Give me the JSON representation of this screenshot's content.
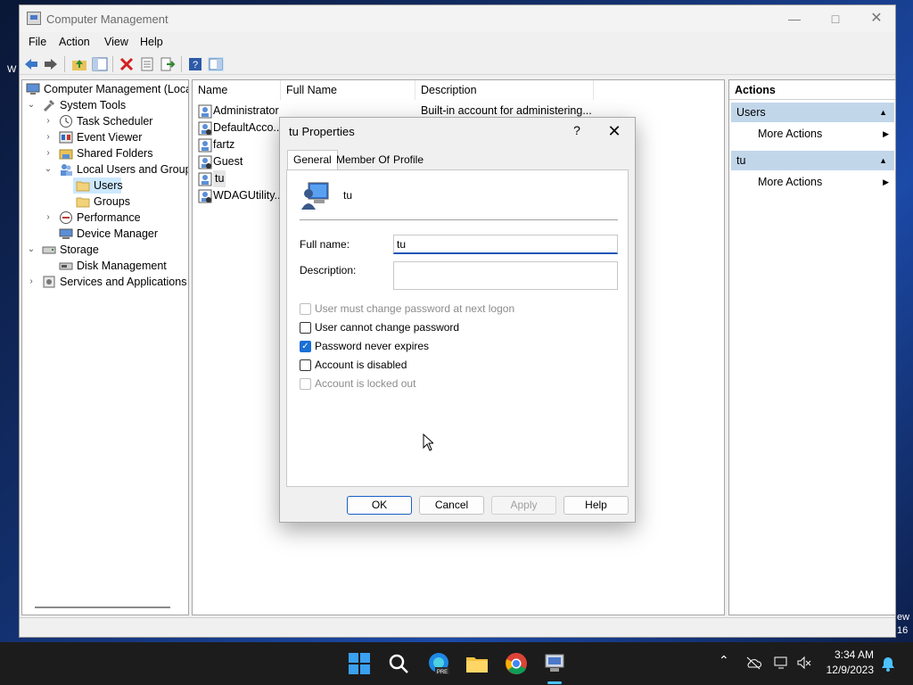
{
  "window": {
    "title": "Computer Management"
  },
  "menu": [
    "File",
    "Action",
    "View",
    "Help"
  ],
  "tree": {
    "items": [
      {
        "label": "Computer Management (Local",
        "icon": "computer-management-icon"
      },
      {
        "label": "System Tools",
        "icon": "system-tools-icon"
      },
      {
        "label": "Task Scheduler",
        "icon": "clock-icon"
      },
      {
        "label": "Event Viewer",
        "icon": "event-viewer-icon"
      },
      {
        "label": "Shared Folders",
        "icon": "shared-folders-icon"
      },
      {
        "label": "Local Users and Groups",
        "icon": "users-groups-icon"
      },
      {
        "label": "Users",
        "icon": "folder-icon"
      },
      {
        "label": "Groups",
        "icon": "folder-icon"
      },
      {
        "label": "Performance",
        "icon": "performance-icon"
      },
      {
        "label": "Device Manager",
        "icon": "device-manager-icon"
      },
      {
        "label": "Storage",
        "icon": "storage-icon"
      },
      {
        "label": "Disk Management",
        "icon": "disk-icon"
      },
      {
        "label": "Services and Applications",
        "icon": "services-icon"
      }
    ]
  },
  "list": {
    "columns": [
      "Name",
      "Full Name",
      "Description"
    ],
    "rows": [
      {
        "name": "Administrator",
        "full_name": "",
        "description": "Built-in account for administering..."
      },
      {
        "name": "DefaultAcco...",
        "full_name": "",
        "description": ""
      },
      {
        "name": "fartz",
        "full_name": "",
        "description": ""
      },
      {
        "name": "Guest",
        "full_name": "",
        "description": ""
      },
      {
        "name": "tu",
        "full_name": "",
        "description": ""
      },
      {
        "name": "WDAGUtility...",
        "full_name": "",
        "description": ""
      }
    ]
  },
  "actions": {
    "header": "Actions",
    "sections": [
      {
        "title": "Users",
        "item": "More Actions"
      },
      {
        "title": "tu",
        "item": "More Actions"
      }
    ]
  },
  "dialog": {
    "title": "tu Properties",
    "help_glyph": "?",
    "tabs": [
      "General",
      "Member Of",
      "Profile"
    ],
    "username": "tu",
    "full_name_label": "Full name:",
    "full_name_value": "tu",
    "description_label": "Description:",
    "description_value": "",
    "checkboxes": [
      {
        "label": "User must change password at next logon",
        "checked": false,
        "enabled": false
      },
      {
        "label": "User cannot change password",
        "checked": false,
        "enabled": true
      },
      {
        "label": "Password never expires",
        "checked": true,
        "enabled": true
      },
      {
        "label": "Account is disabled",
        "checked": false,
        "enabled": true
      },
      {
        "label": "Account is locked out",
        "checked": false,
        "enabled": false
      }
    ],
    "buttons": {
      "ok": "OK",
      "cancel": "Cancel",
      "apply": "Apply",
      "help": "Help"
    }
  },
  "desktop": {
    "frag_left": "W",
    "frag_right_1": "ew",
    "frag_right_2": "16"
  },
  "taskbar": {
    "time": "3:34 AM",
    "date": "12/9/2023",
    "edge_badge": "PRE"
  }
}
